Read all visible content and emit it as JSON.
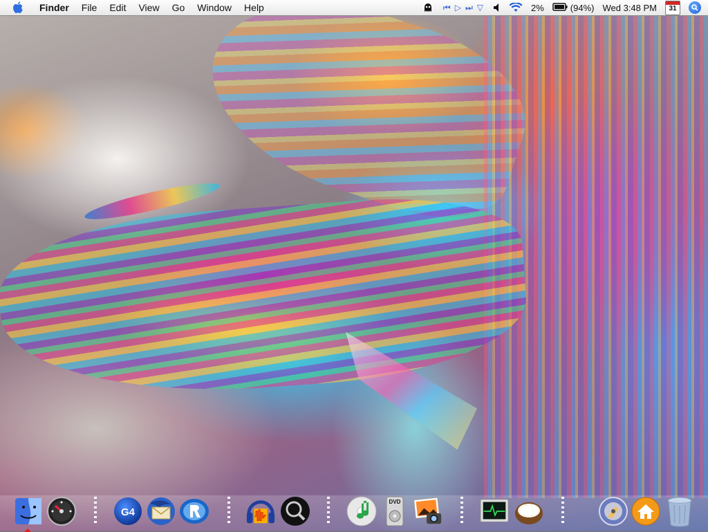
{
  "menubar": {
    "apple_icon": "apple-icon",
    "app_name": "Finder",
    "menus": [
      "File",
      "Edit",
      "View",
      "Go",
      "Window",
      "Help"
    ],
    "status": {
      "ghost_icon": "ghost-icon",
      "media_controls": [
        "previous-icon",
        "play-icon",
        "next-icon",
        "eject-icon"
      ],
      "volume_icon": "speaker-icon",
      "wifi_icon": "wifi-icon",
      "cpu": "2%",
      "battery_icon": "battery-icon",
      "battery": "(94%)",
      "clock": "Wed 3:48 PM",
      "calendar_day": "31",
      "spotlight_icon": "spotlight-icon"
    }
  },
  "dock": {
    "items": [
      {
        "name": "finder-icon",
        "running": true
      },
      {
        "name": "dashboard-icon",
        "running": false
      },
      {
        "name": "g4-icon",
        "label": "G4",
        "running": false
      },
      {
        "name": "thunderbird-icon",
        "running": false
      },
      {
        "name": "realplayer-icon",
        "running": false
      },
      {
        "name": "audacity-icon",
        "running": false
      },
      {
        "name": "spotlight-app-icon",
        "running": false
      },
      {
        "name": "itunes-icon",
        "running": false
      },
      {
        "name": "dvd-player-icon",
        "label": "DVD",
        "running": false
      },
      {
        "name": "iphoto-icon",
        "running": false
      },
      {
        "name": "activity-monitor-icon",
        "running": false
      },
      {
        "name": "coconut-icon",
        "running": false
      },
      {
        "name": "disk-utility-icon",
        "running": false
      },
      {
        "name": "home-folder-icon",
        "running": false
      },
      {
        "name": "trash-icon",
        "running": false
      }
    ]
  },
  "colors": {
    "accent": "#3f68d8",
    "menubar": "#f3f3f3",
    "running_indicator": "#e0201e"
  }
}
